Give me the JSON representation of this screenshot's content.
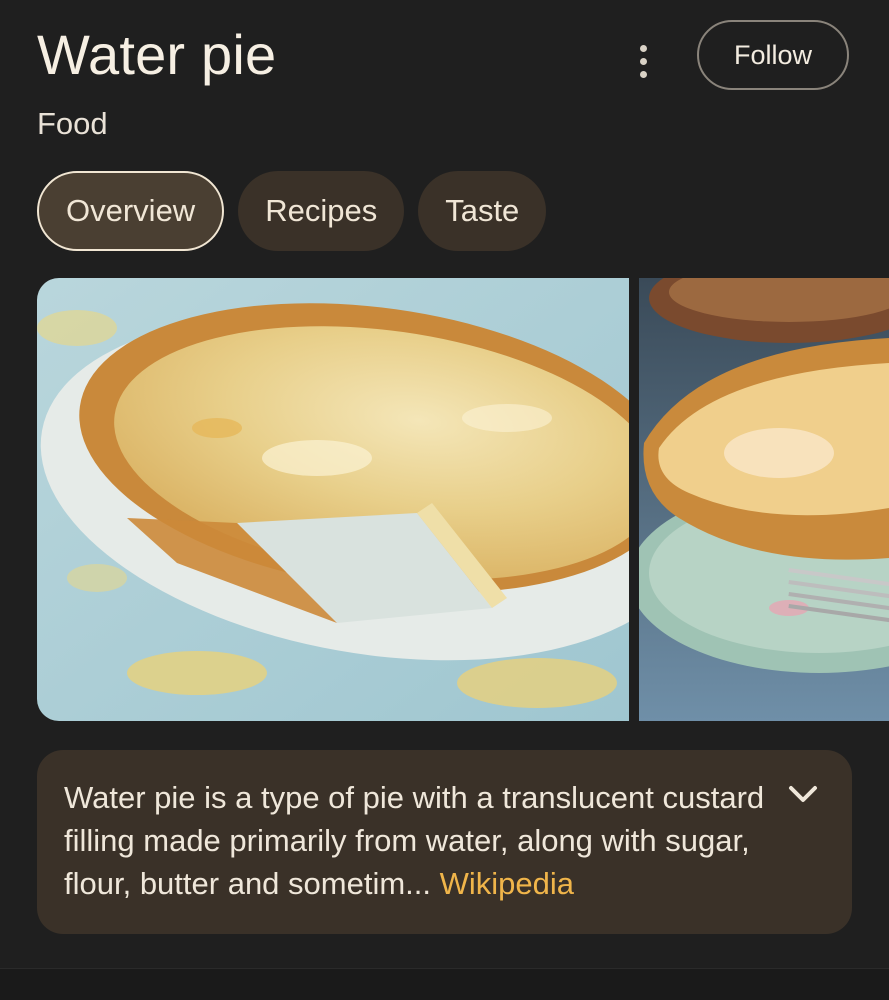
{
  "header": {
    "title": "Water pie",
    "category": "Food",
    "follow_label": "Follow",
    "more_icon": "more-vert-icon"
  },
  "tabs": [
    {
      "label": "Overview",
      "active": true
    },
    {
      "label": "Recipes",
      "active": false
    },
    {
      "label": "Taste",
      "active": false
    }
  ],
  "description": {
    "text": "Water pie is a type of pie with a translucent custard filling made primarily from water, along with sugar, flour, butter and sometim",
    "ellipsis": "...",
    "source_link": "Wikipedia",
    "expand_icon": "chevron-down-icon"
  },
  "colors": {
    "background": "#1f1f1f",
    "chip_bg": "#3a3128",
    "link": "#f0b54a"
  }
}
